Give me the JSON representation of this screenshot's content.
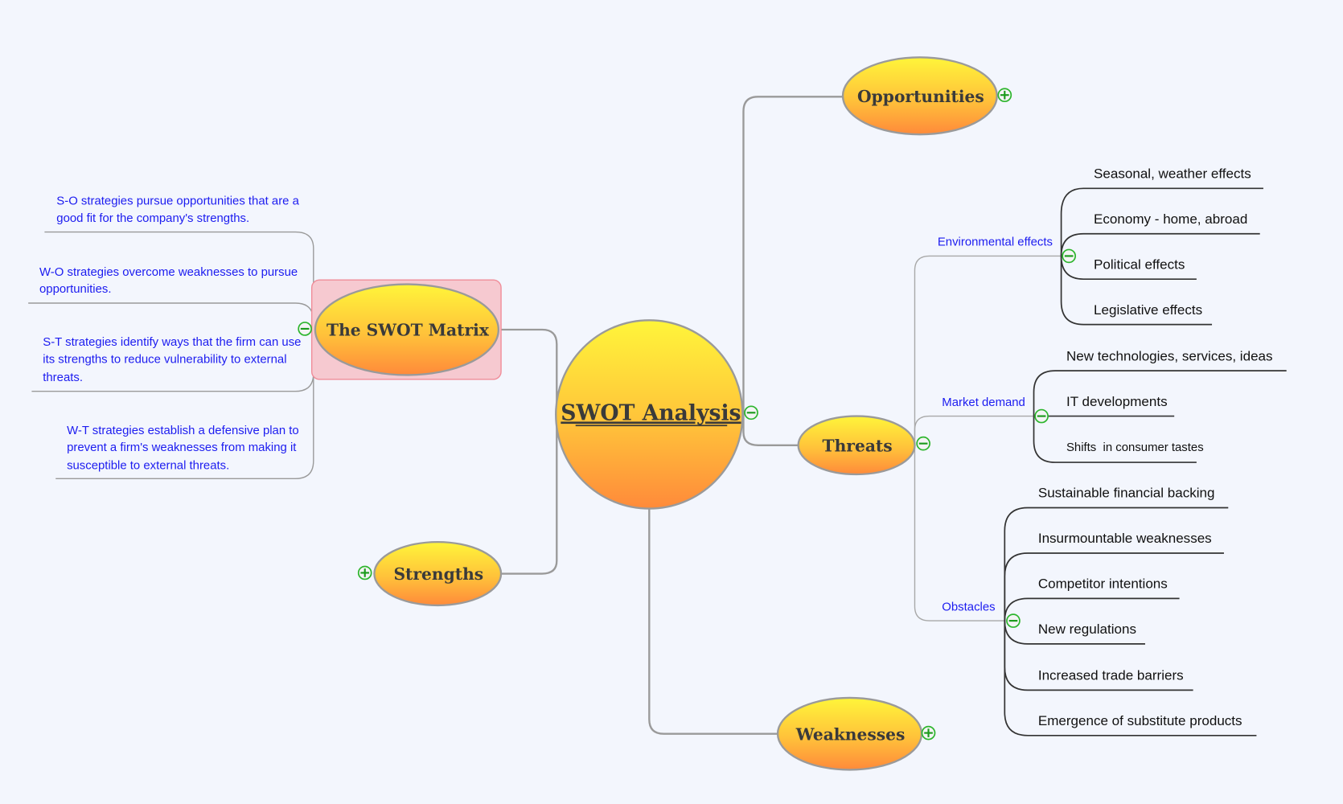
{
  "map_title": "SWOT Analysis",
  "central": {
    "label": "SWOT Analysis",
    "toggle": "collapse"
  },
  "colors": {
    "background": "#f3f6fd",
    "node_gradient_top": "#fff53a",
    "node_gradient_bottom": "#ff8a3a",
    "node_border": "#9a9a9a",
    "subtopic_text": "#1c1cf0",
    "leaf_text": "#111111",
    "toggle_green": "#2db52d",
    "selection_highlight": "#f6c9d0"
  },
  "topics": {
    "opportunities": {
      "label": "Opportunities",
      "toggle": "expand"
    },
    "threats": {
      "label": "Threats",
      "toggle": "collapse"
    },
    "weaknesses": {
      "label": "Weaknesses",
      "toggle": "expand"
    },
    "strengths": {
      "label": "Strengths",
      "toggle": "expand"
    },
    "matrix": {
      "label": "The SWOT Matrix",
      "toggle": "collapse",
      "selected": true
    }
  },
  "threats_branches": [
    {
      "label": "Environmental effects",
      "children": [
        "Seasonal, weather effects",
        "Economy - home, abroad",
        "Political effects",
        "Legislative effects"
      ]
    },
    {
      "label": "Market demand",
      "children": [
        "New technologies, services, ideas",
        "IT developments",
        "Shifts  in consumer tastes"
      ]
    },
    {
      "label": "Obstacles",
      "children": [
        "Sustainable financial backing",
        "Insurmountable weaknesses",
        "Competitor intentions",
        "New regulations",
        "Increased trade barriers",
        "Emergence of substitute products"
      ]
    }
  ],
  "matrix_notes": [
    [
      "S-O strategies pursue opportunities that are a",
      "good fit for the company's strengths."
    ],
    [
      "W-O strategies overcome weaknesses to pursue",
      "opportunities."
    ],
    [
      "S-T strategies identify ways that the firm can use",
      "its strengths to reduce vulnerability to external",
      "threats."
    ],
    [
      "W-T strategies establish a defensive plan to",
      "prevent a firm's weaknesses from making it",
      "susceptible to external threats."
    ]
  ]
}
